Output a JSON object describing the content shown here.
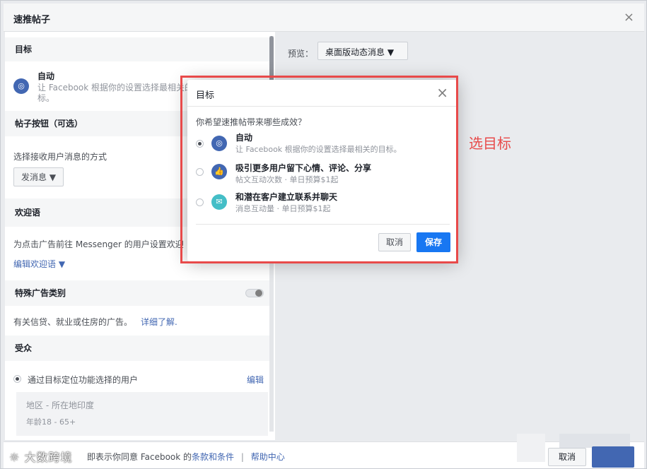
{
  "window": {
    "title": "速推帖子",
    "close_glyph": "×"
  },
  "left": {
    "goal_section": "目标",
    "goal_option_title": "自动",
    "goal_option_desc_1": "让 Facebook 根据你的设置选择最相关的",
    "goal_option_desc_2": "标。",
    "post_button_section": "帖子按钮（可选）",
    "receive_label": "选择接收用户消息的方式",
    "send_message_button": "发消息",
    "welcome_section": "欢迎语",
    "welcome_desc": "为点击广告前往 Messenger 的用户设置欢迎",
    "edit_welcome_link": "编辑欢迎语",
    "special_category_section": "特殊广告类别",
    "special_category_desc": "有关信贷、就业或住房的广告。",
    "learn_more_link": "详细了解.",
    "audience_section": "受众",
    "audience_option": "通过目标定位功能选择的用户",
    "edit_link": "编辑",
    "location_line": "地区 - 所在地印度",
    "age_line": "年龄18 - 65+"
  },
  "preview": {
    "label": "预览：",
    "selected": "桌面版动态消息"
  },
  "footer": {
    "watermark": "大数跨境",
    "terms_prefix": "即表示你同意 Facebook 的",
    "terms_link": "条款和条件",
    "separator": "|",
    "help_link": "帮助中心",
    "cancel_label": "取消"
  },
  "dialog": {
    "title": "目标",
    "close_glyph": "×",
    "question": "你希望速推帖带来哪些成效？",
    "options": [
      {
        "title": "自动",
        "subtitle": "让 Facebook 根据你的设置选择最相关的目标。",
        "selected": true,
        "icon": "auto-target-icon",
        "color": "#4267b2"
      },
      {
        "title": "吸引更多用户留下心情、评论、分享",
        "subtitle": "帖文互动次数 · 单日预算$1起",
        "selected": false,
        "icon": "thumbs-up-icon",
        "color": "#4267b2"
      },
      {
        "title": "和潜在客户建立联系并聊天",
        "subtitle": "消息互动量 · 单日预算$1起",
        "selected": false,
        "icon": "messenger-icon",
        "color": "#44bec7"
      }
    ],
    "cancel_label": "取消",
    "save_label": "保存"
  },
  "annotation": {
    "text": "选目标",
    "color": "#e84a4a"
  }
}
